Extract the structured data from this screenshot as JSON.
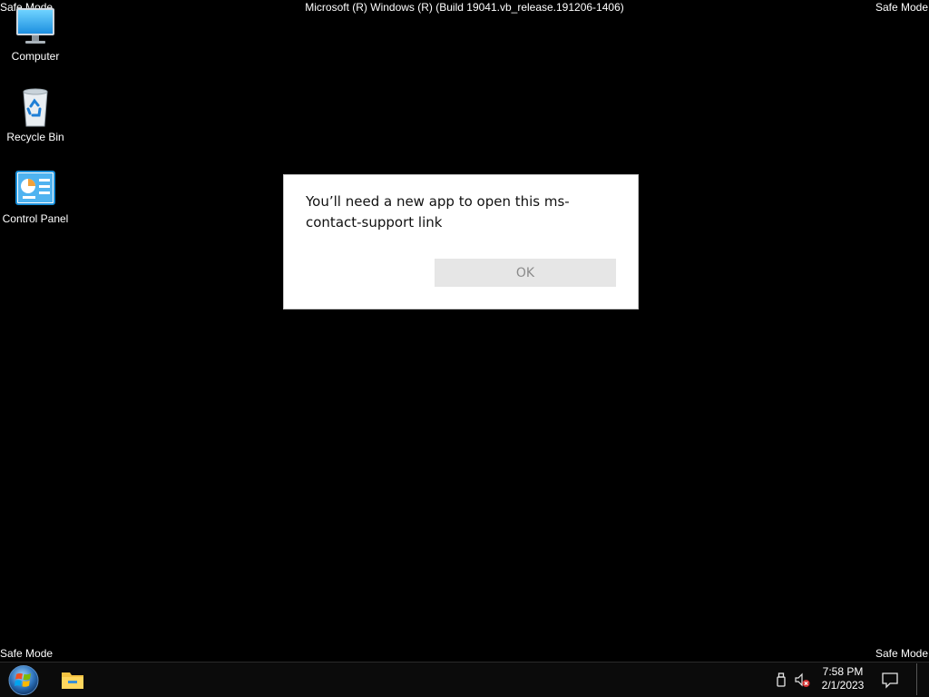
{
  "watermarks": {
    "top_left": "Safe Mode",
    "top_right": "Safe Mode",
    "bottom_left": "Safe Mode",
    "bottom_right": "Safe Mode",
    "top_center": "Microsoft (R) Windows (R) (Build 19041.vb_release.191206-1406)"
  },
  "desktop_icons": [
    {
      "label": "Computer",
      "icon": "computer-icon"
    },
    {
      "label": "Recycle Bin",
      "icon": "recycle-bin-icon"
    },
    {
      "label": "Control Panel",
      "icon": "control-panel-icon"
    }
  ],
  "dialog": {
    "message": "You’ll need a new app to open this ms-contact-support link",
    "ok_label": "OK"
  },
  "taskbar": {
    "start_icon": "windows-start-icon",
    "pinned_app_icon": "file-explorer-icon",
    "tray_icons": [
      "usb-device-icon",
      "volume-muted-icon"
    ],
    "clock_time": "7:58 PM",
    "clock_date": "2/1/2023",
    "action_center_icon": "action-center-icon"
  },
  "colors": {
    "desktop_background": "#000000",
    "dialog_background": "#ffffff",
    "button_background": "#e6e6e6",
    "button_text": "#8a8a8a"
  }
}
